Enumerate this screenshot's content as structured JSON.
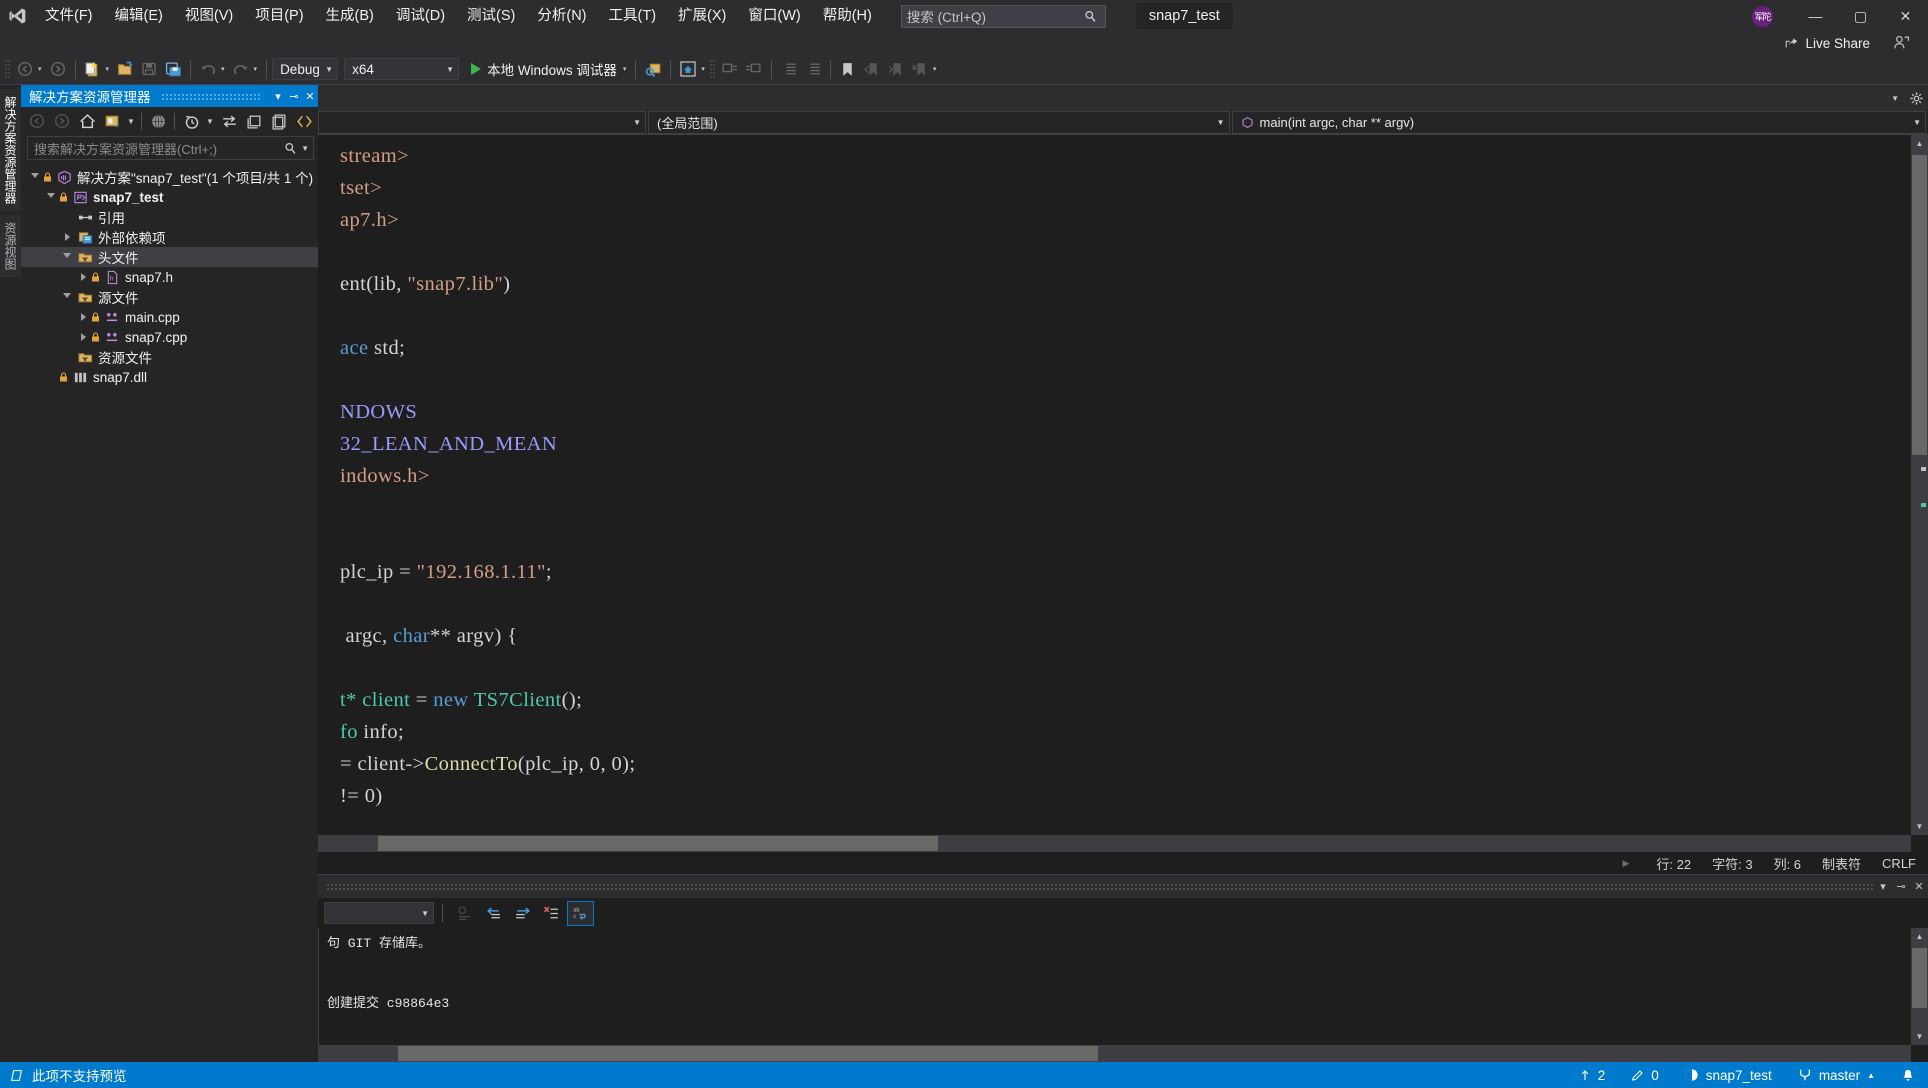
{
  "window": {
    "app_logo": "visual-studio-logo",
    "project_title": "snap7_test",
    "avatar_initials": "军陀",
    "minimize": "—",
    "maximize": "▢",
    "close": "✕"
  },
  "menu": {
    "items": [
      {
        "label": "文件(F)",
        "name": "menu-file"
      },
      {
        "label": "编辑(E)",
        "name": "menu-edit"
      },
      {
        "label": "视图(V)",
        "name": "menu-view"
      },
      {
        "label": "项目(P)",
        "name": "menu-project"
      },
      {
        "label": "生成(B)",
        "name": "menu-build"
      },
      {
        "label": "调试(D)",
        "name": "menu-debug"
      },
      {
        "label": "测试(S)",
        "name": "menu-test"
      },
      {
        "label": "分析(N)",
        "name": "menu-analyze"
      },
      {
        "label": "工具(T)",
        "name": "menu-tools"
      },
      {
        "label": "扩展(X)",
        "name": "menu-extensions"
      },
      {
        "label": "窗口(W)",
        "name": "menu-window"
      },
      {
        "label": "帮助(H)",
        "name": "menu-help"
      }
    ]
  },
  "search": {
    "placeholder": "搜索 (Ctrl+Q)",
    "icon": "search-icon"
  },
  "liveshare": {
    "label": "Live Share"
  },
  "toolbar": {
    "configuration": "Debug",
    "platform": "x64",
    "run_label": "本地 Windows 调试器"
  },
  "vtabs": [
    {
      "label": "解决方案资源管理器",
      "selected": true
    },
    {
      "label": "资源视图",
      "selected": false
    }
  ],
  "solution_explorer": {
    "title": "解决方案资源管理器",
    "search_placeholder": "搜索解决方案资源管理器(Ctrl+;)",
    "tree": [
      {
        "label": "解决方案\"snap7_test\"(1 个项目/共 1 个)",
        "icon": "solution-icon",
        "indent": 0,
        "twisty": "open",
        "bold": false,
        "selected": false
      },
      {
        "label": "snap7_test",
        "icon": "cpp-project-icon",
        "indent": 1,
        "twisty": "open",
        "bold": true,
        "selected": false
      },
      {
        "label": "引用",
        "icon": "references-icon",
        "indent": 2,
        "twisty": "none",
        "bold": false,
        "selected": false
      },
      {
        "label": "外部依赖项",
        "icon": "external-deps-icon",
        "indent": 2,
        "twisty": "closed",
        "bold": false,
        "selected": false
      },
      {
        "label": "头文件",
        "icon": "filter-folder-icon",
        "indent": 2,
        "twisty": "open",
        "bold": false,
        "selected": true
      },
      {
        "label": "snap7.h",
        "icon": "header-file-icon",
        "indent": 3,
        "twisty": "closed",
        "bold": false,
        "selected": false
      },
      {
        "label": "源文件",
        "icon": "filter-folder-icon",
        "indent": 2,
        "twisty": "open",
        "bold": false,
        "selected": false
      },
      {
        "label": "main.cpp",
        "icon": "cpp-file-icon",
        "indent": 3,
        "twisty": "closed",
        "bold": false,
        "selected": false
      },
      {
        "label": "snap7.cpp",
        "icon": "cpp-file-icon",
        "indent": 3,
        "twisty": "closed",
        "bold": false,
        "selected": false
      },
      {
        "label": "资源文件",
        "icon": "filter-folder-icon",
        "indent": 2,
        "twisty": "none",
        "bold": false,
        "selected": false
      },
      {
        "label": "snap7.dll",
        "icon": "dll-file-icon",
        "indent": 1,
        "twisty": "none",
        "bold": false,
        "selected": false
      }
    ]
  },
  "editor": {
    "nav_project": "",
    "nav_scope": "(全局范围)",
    "nav_member": "main(int argc, char ** argv)",
    "code_lines": [
      {
        "segments": [
          {
            "t": "stream>",
            "c": "str"
          }
        ]
      },
      {
        "segments": [
          {
            "t": "tset>",
            "c": "str"
          }
        ]
      },
      {
        "segments": [
          {
            "t": "ap7.h>",
            "c": "str"
          }
        ]
      },
      {
        "segments": [
          {
            "t": "",
            "c": ""
          }
        ]
      },
      {
        "segments": [
          {
            "t": "ent(lib, ",
            "c": ""
          },
          {
            "t": "\"snap7.lib\"",
            "c": "str"
          },
          {
            "t": ")",
            "c": ""
          }
        ]
      },
      {
        "segments": [
          {
            "t": "",
            "c": ""
          }
        ]
      },
      {
        "segments": [
          {
            "t": "ace",
            "c": "kw"
          },
          {
            "t": " std;",
            "c": ""
          }
        ]
      },
      {
        "segments": [
          {
            "t": "",
            "c": ""
          }
        ]
      },
      {
        "segments": [
          {
            "t": "NDOWS",
            "c": "pre"
          }
        ]
      },
      {
        "segments": [
          {
            "t": "32_LEAN_AND_MEAN",
            "c": "pre"
          }
        ]
      },
      {
        "segments": [
          {
            "t": "indows.h>",
            "c": "str"
          }
        ]
      },
      {
        "segments": [
          {
            "t": "",
            "c": ""
          }
        ]
      },
      {
        "segments": [
          {
            "t": "",
            "c": ""
          }
        ]
      },
      {
        "segments": [
          {
            "t": "plc_ip = ",
            "c": ""
          },
          {
            "t": "\"192.168.1.11\"",
            "c": "str"
          },
          {
            "t": ";",
            "c": ""
          }
        ]
      },
      {
        "segments": [
          {
            "t": "",
            "c": ""
          }
        ]
      },
      {
        "segments": [
          {
            "t": " argc, ",
            "c": ""
          },
          {
            "t": "char",
            "c": "kw"
          },
          {
            "t": "** argv) {",
            "c": ""
          }
        ]
      },
      {
        "segments": [
          {
            "t": "",
            "c": ""
          }
        ]
      },
      {
        "segments": [
          {
            "t": "t* ",
            "c": "typ"
          },
          {
            "t": "client",
            "c": "typ"
          },
          {
            "t": " = ",
            "c": ""
          },
          {
            "t": "new",
            "c": "kw"
          },
          {
            "t": " ",
            "c": ""
          },
          {
            "t": "TS7Client",
            "c": "typ"
          },
          {
            "t": "();",
            "c": ""
          }
        ]
      },
      {
        "segments": [
          {
            "t": "fo",
            "c": "typ"
          },
          {
            "t": " info;",
            "c": ""
          }
        ]
      },
      {
        "segments": [
          {
            "t": "= client->",
            "c": ""
          },
          {
            "t": "ConnectTo",
            "c": "fn"
          },
          {
            "t": "(plc_ip, ",
            "c": ""
          },
          {
            "t": "0",
            "c": ""
          },
          {
            "t": ", ",
            "c": ""
          },
          {
            "t": "0",
            "c": ""
          },
          {
            "t": ");",
            "c": ""
          }
        ]
      },
      {
        "segments": [
          {
            "t": "!= ",
            "c": ""
          },
          {
            "t": "0",
            "c": ""
          },
          {
            "t": ")",
            "c": ""
          }
        ]
      }
    ],
    "status": {
      "line_label": "行: 22",
      "char_label": "字符: 3",
      "col_label": "列: 6",
      "insert_label": "制表符",
      "eol_label": "CRLF"
    }
  },
  "output": {
    "filter_value": "",
    "lines": [
      "句 GIT 存储库。",
      "",
      "",
      "创建提交 c98864e3"
    ]
  },
  "statusbar": {
    "message": "此项不支持预览",
    "outgoing_count": "2",
    "edit_count": "0",
    "repo_name": "snap7_test",
    "branch_name": "master"
  }
}
